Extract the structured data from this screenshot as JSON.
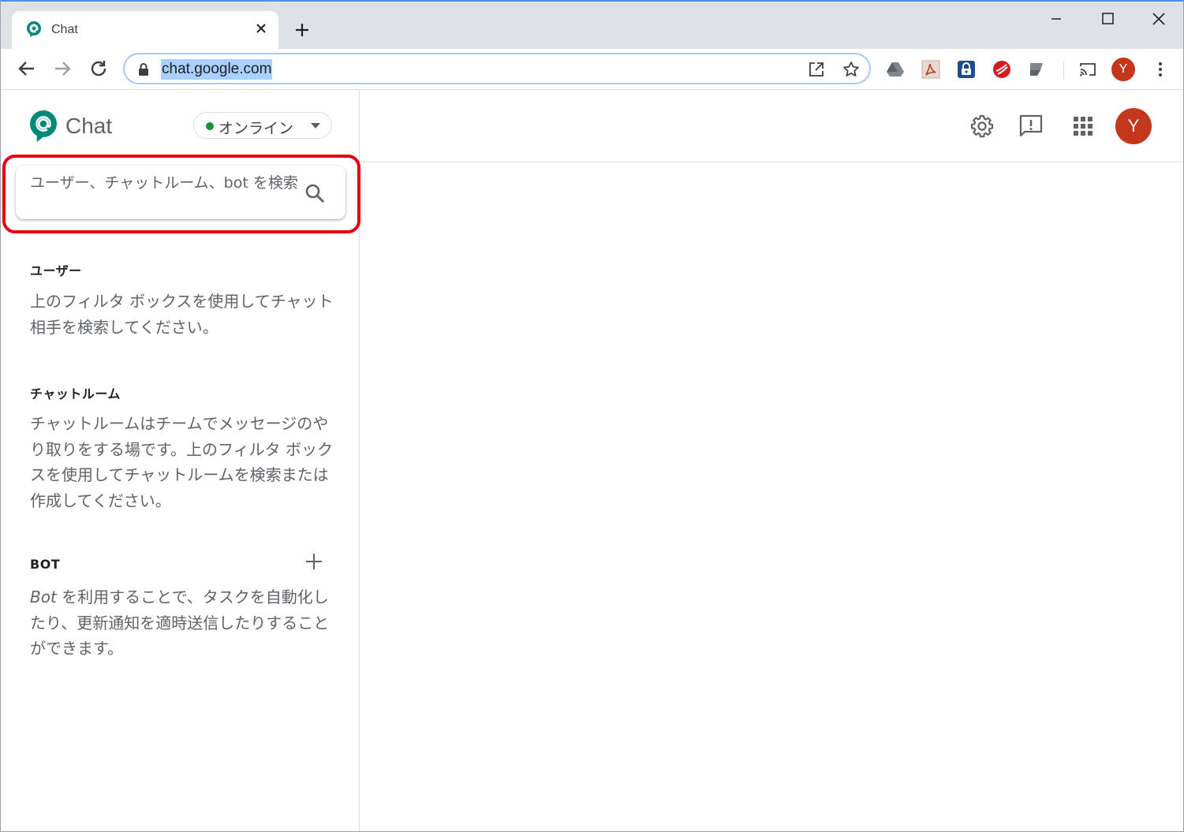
{
  "browser": {
    "tab": {
      "title": "Chat"
    },
    "address_bar": {
      "url": "chat.google.com"
    },
    "profile_initial": "Y"
  },
  "app": {
    "name": "Chat",
    "status": {
      "label": "オンライン",
      "color": "#1e8e3e"
    },
    "search": {
      "placeholder": "ユーザー、チャットルーム、bot を検索"
    },
    "sections": {
      "users": {
        "title": "ユーザー",
        "description": "上のフィルタ ボックスを使用してチャット相手を検索してください。"
      },
      "rooms": {
        "title": "チャットルーム",
        "description": "チャットルームはチームでメッセージのやり取りをする場です。上のフィルタ ボックスを使用してチャットルームを検索または作成してください。"
      },
      "bots": {
        "title": "BOT",
        "description_italic": "Bot",
        "description": " を利用することで、タスクを自動化したり、更新通知を適時送信したりすることができます。"
      }
    },
    "header": {
      "avatar_initial": "Y"
    },
    "colors": {
      "brand": "#00897b",
      "avatar": "#c5371b",
      "highlight": "#e60012"
    },
    "icons": [
      "settings-icon",
      "feedback-icon",
      "apps-grid-icon",
      "search-icon",
      "add-icon"
    ]
  }
}
